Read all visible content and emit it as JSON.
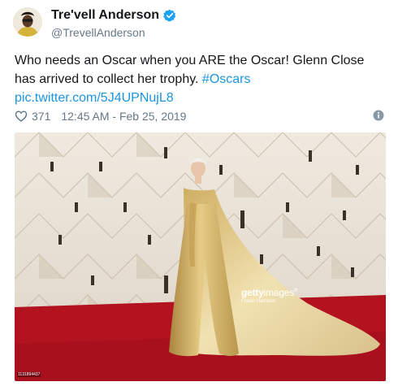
{
  "user": {
    "display_name": "Tre'vell Anderson",
    "handle": "@TrevellAnderson",
    "avatar_icon": "avatar",
    "verified_icon": "verified-badge-icon"
  },
  "tweet": {
    "text_main": "Who needs an Oscar when you ARE the Oscar! Glenn Close has arrived to collect her trophy. ",
    "hashtag": "#Oscars",
    "link": "pic.twitter.com/5J4UPNujL8",
    "likes": "371",
    "timestamp": "12:45 AM - Feb 25, 2019"
  },
  "photo": {
    "watermark_brand_bold": "getty",
    "watermark_brand_light": "images",
    "watermark_registered": "®",
    "watermark_credit": "Frazer Harrison",
    "photo_id": "1131894437"
  },
  "colors": {
    "link": "#1b95e0",
    "muted": "#657786",
    "verified": "#1da1f2",
    "carpet": "#b3121f",
    "gown": "#d9b868"
  },
  "icons": {
    "like": "heart-icon",
    "info": "info-icon"
  }
}
